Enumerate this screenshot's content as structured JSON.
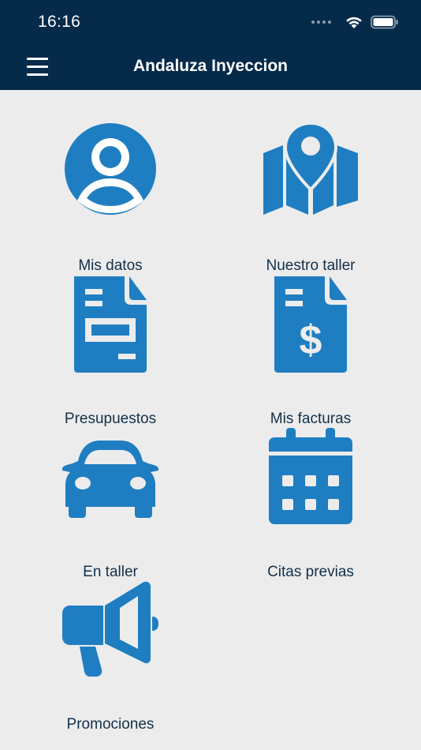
{
  "status_bar": {
    "time": "16:16"
  },
  "header": {
    "title": "Andaluza Inyeccion",
    "menu_icon": "hamburger-menu-icon"
  },
  "colors": {
    "header_bg": "#062a4a",
    "icon_blue": "#1f7ec1",
    "page_bg": "#ececec",
    "label_text": "#13304a"
  },
  "menu": {
    "items": [
      {
        "label": "Mis datos",
        "icon": "user-profile-icon"
      },
      {
        "label": "Nuestro taller",
        "icon": "map-pin-icon"
      },
      {
        "label": "Presupuestos",
        "icon": "document-icon"
      },
      {
        "label": "Mis facturas",
        "icon": "invoice-dollar-icon"
      },
      {
        "label": "En taller",
        "icon": "car-icon"
      },
      {
        "label": "Citas previas",
        "icon": "calendar-icon"
      },
      {
        "label": "Promociones",
        "icon": "megaphone-icon"
      }
    ]
  }
}
